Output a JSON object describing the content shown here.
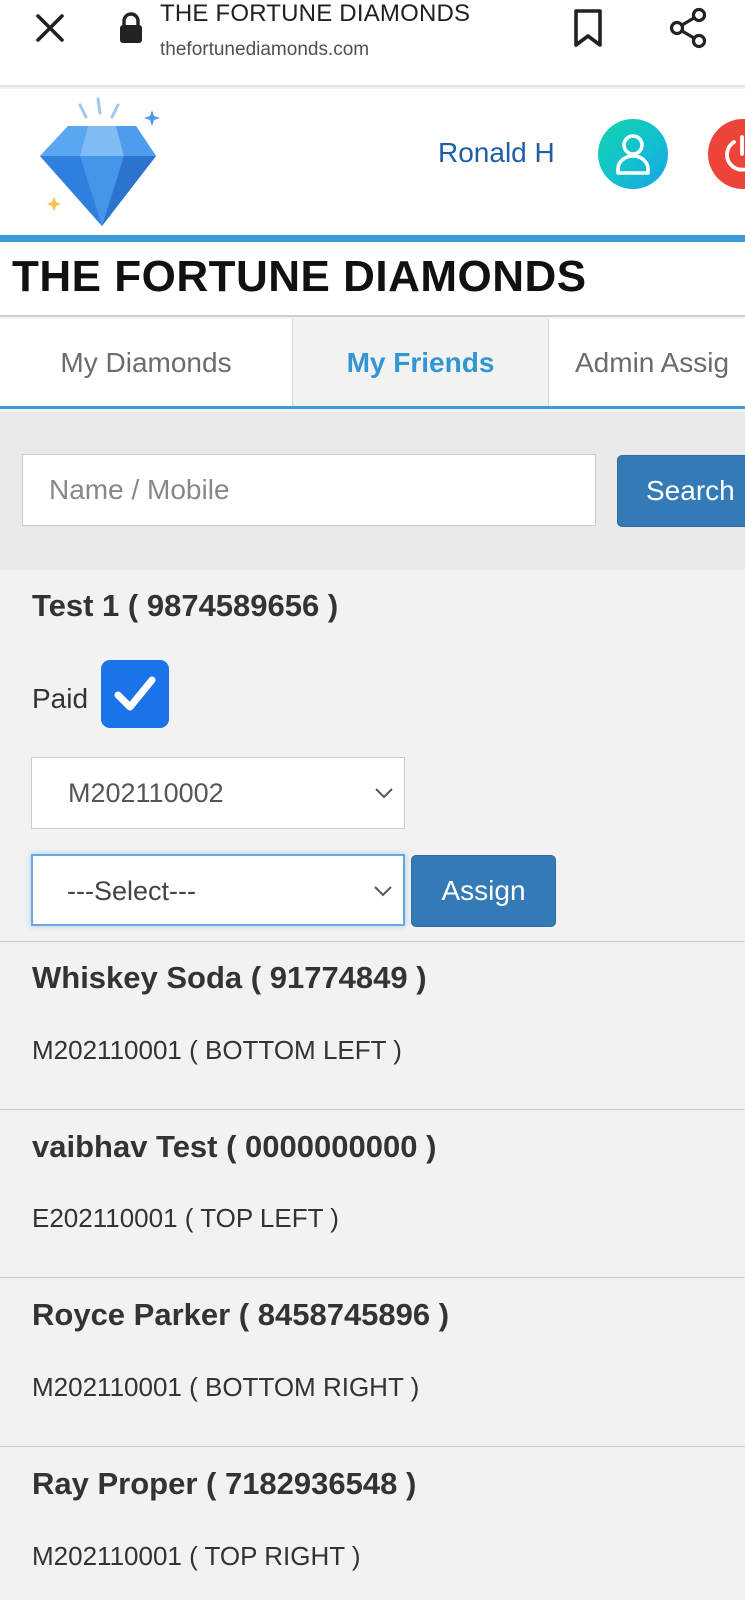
{
  "browser": {
    "page_title": "THE FORTUNE DIAMONDS",
    "url": "thefortunediamonds.com"
  },
  "header": {
    "user_name": "Ronald H",
    "logo_icon": "diamond-icon",
    "avatar_icon": "user-icon",
    "logout_icon": "power-icon"
  },
  "site": {
    "title": "THE FORTUNE DIAMONDS"
  },
  "tabs": [
    {
      "label": "My Diamonds",
      "active": false
    },
    {
      "label": "My Friends",
      "active": true
    },
    {
      "label": "Admin Assig",
      "active": false
    }
  ],
  "search": {
    "placeholder": "Name / Mobile",
    "button_label": "Search"
  },
  "current_friend": {
    "name": "Test 1 ( 9874589656 )",
    "paid_label": "Paid",
    "paid": true,
    "diamond_select": "M202110002",
    "position_select": "---Select---",
    "assign_label": "Assign"
  },
  "friends": [
    {
      "name": "Whiskey Soda ( 91774849 )",
      "detail": "M202110001 ( BOTTOM LEFT )"
    },
    {
      "name": "vaibhav Test ( 0000000000 )",
      "detail": "E202110001 ( TOP LEFT )"
    },
    {
      "name": "Royce Parker ( 8458745896 )",
      "detail": "M202110001 ( BOTTOM RIGHT )"
    },
    {
      "name": "Ray Proper ( 7182936548 )",
      "detail": "M202110001 ( TOP RIGHT )"
    }
  ],
  "colors": {
    "brand_blue": "#337ab7",
    "accent_blue": "#3a9bd6",
    "checkbox_blue": "#1a73e8",
    "logout_red": "#ee4338"
  }
}
